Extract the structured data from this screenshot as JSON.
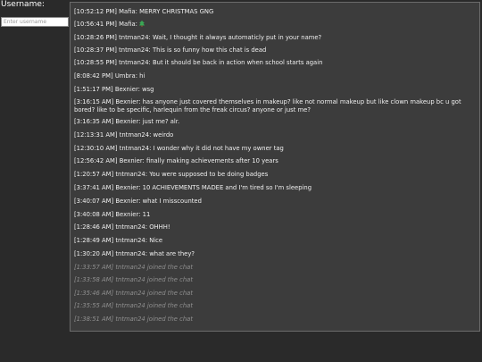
{
  "username": {
    "label": "Username:",
    "placeholder": "Enter username",
    "value": ""
  },
  "messages": [
    {
      "time": "[10:52:12 PM]",
      "author": "Mafia",
      "text": "MERRY CHRISTMAS GNG",
      "system": false
    },
    {
      "time": "[10:56:41 PM]",
      "author": "Mafia",
      "text": "",
      "icon": "christmas-tree-icon",
      "system": false
    },
    {
      "time": "[10:28:26 PM]",
      "author": "tntman24",
      "text": "Wait, I thought it always automaticly put in your name?",
      "system": false
    },
    {
      "time": "[10:28:37 PM]",
      "author": "tntman24",
      "text": "This is so funny how this chat is dead",
      "system": false
    },
    {
      "time": "[10:28:55 PM]",
      "author": "tntman24",
      "text": "But it should be back in action when school starts again",
      "system": false
    },
    {
      "time": "[8:08:42 PM]",
      "author": "Umbra",
      "text": "hi",
      "system": false
    },
    {
      "time": "[1:51:17 PM]",
      "author": "Bexnier",
      "text": "wsg",
      "system": false
    },
    {
      "time": "[3:16:15 AM]",
      "author": "Bexnier",
      "text": "has anyone just covered themselves in makeup? like not normal makeup but like clown makeup bc u got bored? like to be specific, harlequin from the freak circus? anyone or just me?",
      "system": false
    },
    {
      "time": "[3:16:35 AM]",
      "author": "Bexnier",
      "text": "just me? alr.",
      "system": false
    },
    {
      "time": "[12:13:31 AM]",
      "author": "tntman24",
      "text": "weirdo",
      "system": false
    },
    {
      "time": "[12:30:10 AM]",
      "author": "tntman24",
      "text": "I wonder why it did not have my owner tag",
      "system": false
    },
    {
      "time": "[12:56:42 AM]",
      "author": "Bexnier",
      "text": "finally making achievements after 10 years",
      "system": false
    },
    {
      "time": "[1:20:57 AM]",
      "author": "tntman24",
      "text": "You were supposed to be doing badges",
      "system": false
    },
    {
      "time": "[3:37:41 AM]",
      "author": "Bexnier",
      "text": "10 ACHIEVEMENTS MADEE and I'm tired so I'm sleeping",
      "system": false
    },
    {
      "time": "[3:40:07 AM]",
      "author": "Bexnier",
      "text": "what I misscounted",
      "system": false
    },
    {
      "time": "[3:40:08 AM]",
      "author": "Bexnier",
      "text": "11",
      "system": false
    },
    {
      "time": "[1:28:46 AM]",
      "author": "tntman24",
      "text": "OHHH!",
      "system": false
    },
    {
      "time": "[1:28:49 AM]",
      "author": "tntman24",
      "text": "Nice",
      "system": false
    },
    {
      "time": "[1:30:20 AM]",
      "author": "tntman24",
      "text": "what are they?",
      "system": false
    },
    {
      "time": "[1:33:57 AM]",
      "author": "",
      "text": "tntman24 joined the chat",
      "system": true
    },
    {
      "time": "[1:33:58 AM]",
      "author": "",
      "text": "tntman24 joined the chat",
      "system": true
    },
    {
      "time": "[1:35:46 AM]",
      "author": "",
      "text": "tntman24 joined the chat",
      "system": true
    },
    {
      "time": "[1:35:55 AM]",
      "author": "",
      "text": "tntman24 joined the chat",
      "system": true
    },
    {
      "time": "[1:38:51 AM]",
      "author": "",
      "text": "tntman24 joined the chat",
      "system": true
    }
  ]
}
